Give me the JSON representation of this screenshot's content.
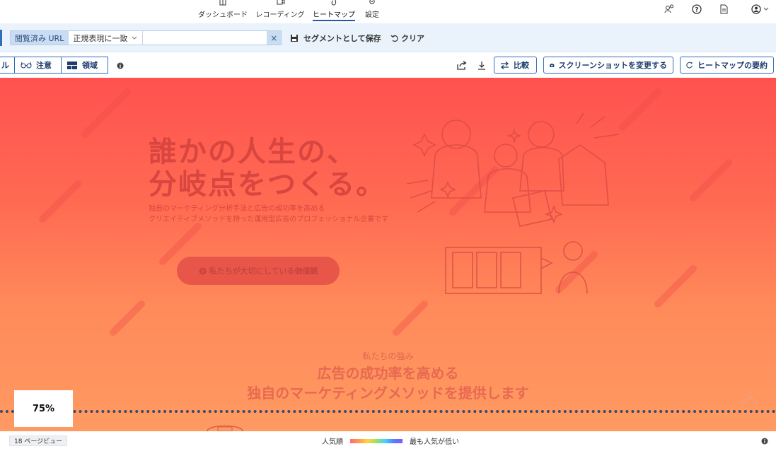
{
  "topnav": {
    "tabs": [
      {
        "label": "ダッシュボード",
        "icon": "dashboard-icon"
      },
      {
        "label": "レコーディング",
        "icon": "recording-icon"
      },
      {
        "label": "ヒートマップ",
        "icon": "heatmap-icon",
        "active": true
      },
      {
        "label": "設定",
        "icon": "gear-icon"
      }
    ],
    "right_icons": [
      "users-icon",
      "help-icon",
      "document-icon",
      "account-icon"
    ]
  },
  "filter": {
    "key": "閲覧済み URL",
    "operator": "正規表現に一致",
    "value": "",
    "save_label": "セグメントとして保存",
    "clear_label": "クリア"
  },
  "toolbar": {
    "mode_partial": "ル",
    "mode_attention": "注意",
    "mode_area": "領域",
    "compare_label": "比較",
    "screenshot_label": "スクリーンショットを変更する",
    "summary_label": "ヒートマップの要約"
  },
  "hero": {
    "title_line1": "誰かの人生の、",
    "title_line2": "分岐点をつくる。",
    "sub_line1": "独自のマーケティング分析手法と広告の成功率を高める",
    "sub_line2": "クリエイティブメソッドを持った運用型広告のプロフェッショナル企業です",
    "cta": "私たちが大切にしている価値観"
  },
  "strength": {
    "kicker": "私たちの強み",
    "title_line1": "広告の成功率を高める",
    "title_line2": "独自のマーケティングメソッドを提供します"
  },
  "fold": {
    "percent": "75%"
  },
  "status": {
    "pageviews": "18 ページビュー",
    "legend_high": "人気順",
    "legend_low": "最も人気が低い"
  },
  "colors": {
    "accent": "#2f6fba",
    "heat_top": "#ff5250",
    "heat_bottom": "#ff9a62"
  }
}
